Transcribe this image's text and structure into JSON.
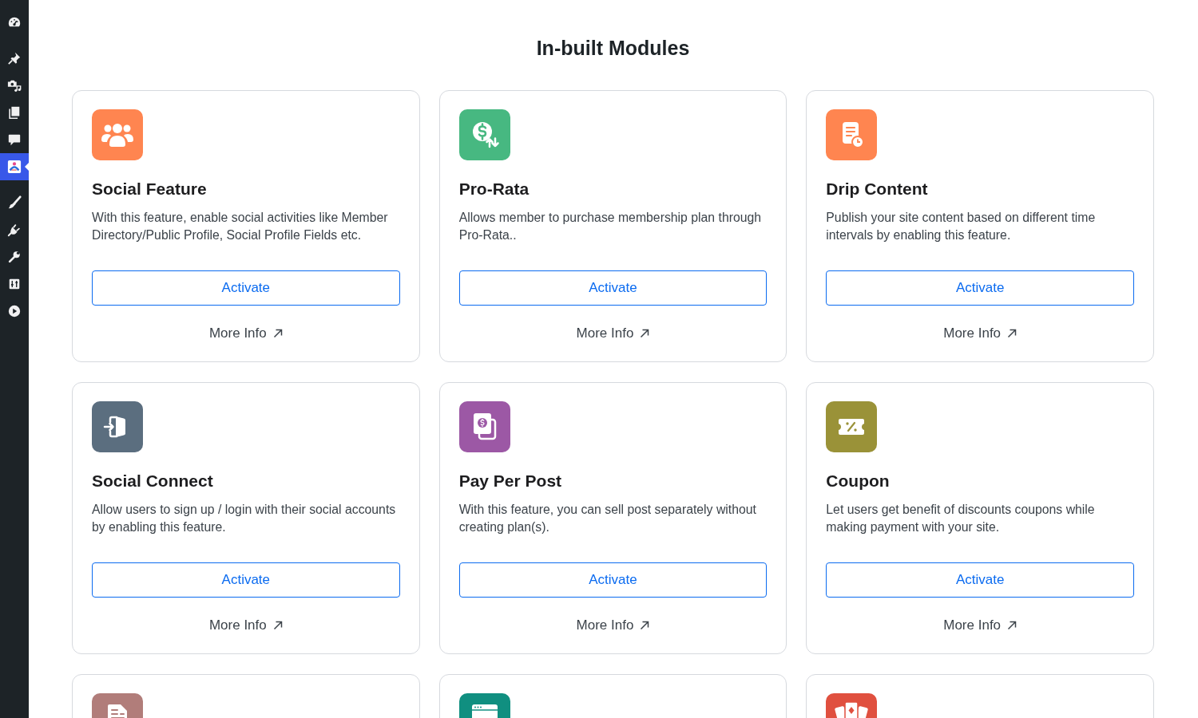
{
  "sidebar": {
    "items": [
      {
        "selected": false
      },
      {
        "selected": false
      },
      {
        "selected": false
      },
      {
        "selected": false
      },
      {
        "selected": false
      },
      {
        "selected": true
      },
      {
        "selected": false
      },
      {
        "selected": false
      },
      {
        "selected": false
      },
      {
        "selected": false
      },
      {
        "selected": false
      }
    ]
  },
  "page_title": "In-built Modules",
  "modules": [
    {
      "title": "Social Feature",
      "description": "With this feature, enable social activities like Member Directory/Public Profile, Social Profile Fields etc.",
      "color": "#ff8550",
      "button": "Activate",
      "link": "More Info"
    },
    {
      "title": "Pro-Rata",
      "description": "Allows member to purchase membership plan through Pro-Rata..",
      "color": "#47b881",
      "button": "Activate",
      "link": "More Info"
    },
    {
      "title": "Drip Content",
      "description": "Publish your site content based on different time intervals by enabling this feature.",
      "color": "#ff8550",
      "button": "Activate",
      "link": "More Info"
    },
    {
      "title": "Social Connect",
      "description": "Allow users to sign up / login with their social accounts by enabling this feature.",
      "color": "#5b6e7f",
      "button": "Activate",
      "link": "More Info"
    },
    {
      "title": "Pay Per Post",
      "description": "With this feature, you can sell post separately without creating plan(s).",
      "color": "#9c58a5",
      "button": "Activate",
      "link": "More Info"
    },
    {
      "title": "Coupon",
      "description": "Let users get benefit of discounts coupons while making payment with your site.",
      "color": "#9a9238",
      "button": "Activate",
      "link": "More Info"
    },
    {
      "color": "#b17d7a"
    },
    {
      "color": "#108f80"
    },
    {
      "color": "#e0503f"
    }
  ]
}
